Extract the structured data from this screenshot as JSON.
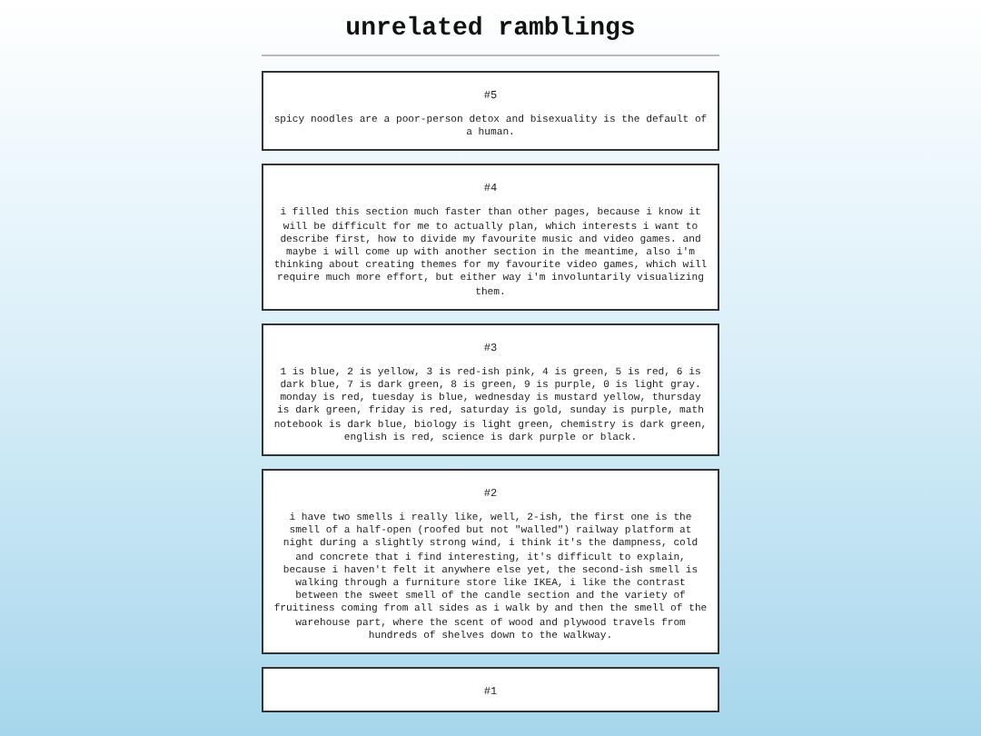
{
  "title": "unrelated ramblings",
  "entries": [
    {
      "number": "#5",
      "text": "spicy noodles are a poor-person detox and bisexuality is the default of a human."
    },
    {
      "number": "#4",
      "text": "i filled this section much faster than other pages, because i know it will be difficult for me to actually plan, which interests i want to describe first, how to divide my favourite music and video games. and maybe i will come up with another section in the meantime, also i'm thinking about creating themes for my favourite video games, which will require much more effort, but either way i'm involuntarily visualizing them."
    },
    {
      "number": "#3",
      "text": "1 is blue, 2 is yellow, 3 is red-ish pink, 4 is green, 5 is red, 6 is dark blue, 7 is dark green, 8 is green, 9 is purple, 0 is light gray. monday is red, tuesday is blue, wednesday is mustard yellow, thursday is dark green, friday is red, saturday is gold, sunday is purple, math notebook is dark blue, biology is light green, chemistry is dark green, english is red, science is dark purple or black."
    },
    {
      "number": "#2",
      "text": "i have two smells i really like, well, 2-ish, the first one is the smell of a half-open (roofed but not \"walled\") railway platform at night during a slightly strong wind, i think it's the dampness, cold and concrete that i find interesting, it's difficult to explain, because i haven't felt it anywhere else yet, the second-ish smell is walking through a furniture store like IKEA, i like the contrast between the sweet smell of the candle section and the variety of fruitiness coming from all sides as i walk by and then the smell of the warehouse part, where the scent of wood and plywood travels from hundreds of shelves down to the walkway."
    },
    {
      "number": "#1"
    }
  ]
}
